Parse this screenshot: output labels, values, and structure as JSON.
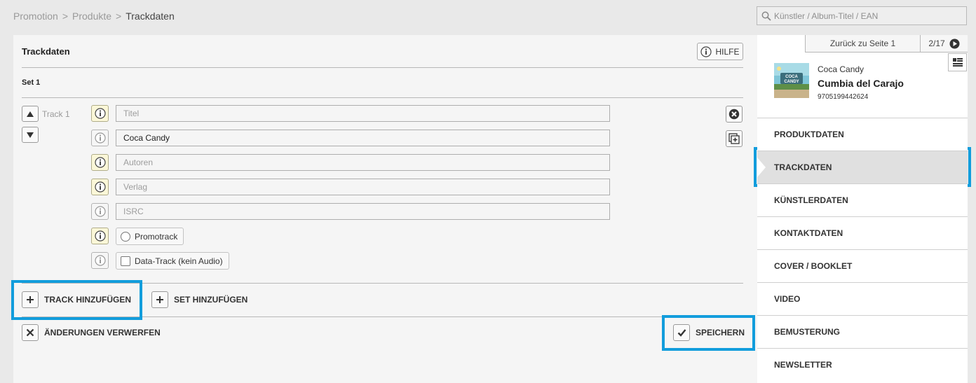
{
  "breadcrumb": {
    "items": [
      "Promotion",
      "Produkte"
    ],
    "separator": ">",
    "current": "Trackdaten"
  },
  "search": {
    "placeholder": "Künstler / Album-Titel / EAN"
  },
  "panel": {
    "title": "Trackdaten",
    "help_label": "HILFE",
    "set_label": "Set 1",
    "track_label": "Track 1",
    "fields": [
      {
        "placeholder": "Titel",
        "value": "",
        "required": true
      },
      {
        "placeholder": "",
        "value": "Coca Candy",
        "required": false
      },
      {
        "placeholder": "Autoren",
        "value": "",
        "required": true
      },
      {
        "placeholder": "Verlag",
        "value": "",
        "required": true
      },
      {
        "placeholder": "ISRC",
        "value": "",
        "required": false
      }
    ],
    "promotrack_label": "Promotrack",
    "datatrack_label": "Data-Track (kein Audio)",
    "add_track_label": "TRACK HINZUFÜGEN",
    "add_set_label": "SET HINZUFÜGEN",
    "discard_label": "ÄNDERUNGEN VERWERFEN",
    "save_label": "SPEICHERN"
  },
  "sidebar": {
    "back_label": "Zurück zu Seite 1",
    "page_indicator": "2/17",
    "product": {
      "artist": "Coca Candy",
      "title": "Cumbia del Carajo",
      "ean": "9705199442624",
      "cover_text": "COCA CANDY"
    },
    "nav": [
      {
        "label": "PRODUKTDATEN",
        "active": false
      },
      {
        "label": "TRACKDATEN",
        "active": true
      },
      {
        "label": "KÜNSTLERDATEN",
        "active": false
      },
      {
        "label": "KONTAKTDATEN",
        "active": false
      },
      {
        "label": "COVER / BOOKLET",
        "active": false
      },
      {
        "label": "VIDEO",
        "active": false
      },
      {
        "label": "BEMUSTERUNG",
        "active": false
      },
      {
        "label": "NEWSLETTER",
        "active": false
      }
    ]
  },
  "colors": {
    "highlight": "#129ddc",
    "required_info_bg": "#fbf7d8"
  },
  "icons": [
    "search-icon",
    "info-icon",
    "arrow-up-icon",
    "arrow-down-icon",
    "remove-track-icon",
    "duplicate-track-icon",
    "plus-icon",
    "close-icon",
    "checkmark-icon",
    "next-page-icon",
    "list-view-icon"
  ]
}
